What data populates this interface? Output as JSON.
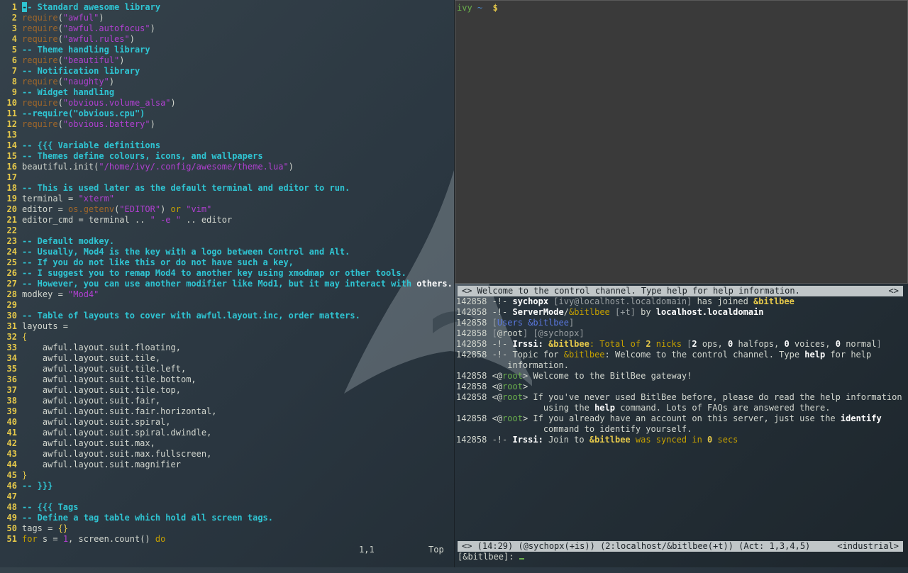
{
  "editor": {
    "lines": [
      [
        [
          "comment",
          "-- Standard awesome library"
        ]
      ],
      [
        [
          "req",
          "require"
        ],
        [
          "plain",
          "("
        ],
        [
          "string",
          "\"awful\""
        ],
        [
          "plain",
          ")"
        ]
      ],
      [
        [
          "req",
          "require"
        ],
        [
          "plain",
          "("
        ],
        [
          "string",
          "\"awful.autofocus\""
        ],
        [
          "plain",
          ")"
        ]
      ],
      [
        [
          "req",
          "require"
        ],
        [
          "plain",
          "("
        ],
        [
          "string",
          "\"awful.rules\""
        ],
        [
          "plain",
          ")"
        ]
      ],
      [
        [
          "comment",
          "-- Theme handling library"
        ]
      ],
      [
        [
          "req",
          "require"
        ],
        [
          "plain",
          "("
        ],
        [
          "string",
          "\"beautiful\""
        ],
        [
          "plain",
          ")"
        ]
      ],
      [
        [
          "comment",
          "-- Notification library"
        ]
      ],
      [
        [
          "req",
          "require"
        ],
        [
          "plain",
          "("
        ],
        [
          "string",
          "\"naughty\""
        ],
        [
          "plain",
          ")"
        ]
      ],
      [
        [
          "comment",
          "-- Widget handling"
        ]
      ],
      [
        [
          "req",
          "require"
        ],
        [
          "plain",
          "("
        ],
        [
          "string",
          "\"obvious.volume_alsa\""
        ],
        [
          "plain",
          ")"
        ]
      ],
      [
        [
          "comment",
          "--require(\"obvious.cpu\")"
        ]
      ],
      [
        [
          "req",
          "require"
        ],
        [
          "plain",
          "("
        ],
        [
          "string",
          "\"obvious.battery\""
        ],
        [
          "plain",
          ")"
        ]
      ],
      [],
      [
        [
          "comment",
          "-- {{{ Variable definitions"
        ]
      ],
      [
        [
          "comment",
          "-- Themes define colours, icons, and wallpapers"
        ]
      ],
      [
        [
          "plain",
          "beautiful.init("
        ],
        [
          "string",
          "\"/home/ivy/.config/awesome/theme.lua\""
        ],
        [
          "plain",
          ")"
        ]
      ],
      [],
      [
        [
          "comment",
          "-- This is used later as the default terminal and editor to run."
        ]
      ],
      [
        [
          "plain",
          "terminal = "
        ],
        [
          "string",
          "\"xterm\""
        ]
      ],
      [
        [
          "plain",
          "editor = "
        ],
        [
          "req",
          "os.getenv"
        ],
        [
          "plain",
          "("
        ],
        [
          "string",
          "\"EDITOR\""
        ],
        [
          "plain",
          ") "
        ],
        [
          "keyword",
          "or"
        ],
        [
          "plain",
          " "
        ],
        [
          "string",
          "\"vim\""
        ]
      ],
      [
        [
          "plain",
          "editor_cmd = terminal .. "
        ],
        [
          "string",
          "\" -e \""
        ],
        [
          "plain",
          " .. editor"
        ]
      ],
      [],
      [
        [
          "comment",
          "-- Default modkey."
        ]
      ],
      [
        [
          "comment",
          "-- Usually, Mod4 is the key with a logo between Control and Alt."
        ]
      ],
      [
        [
          "comment",
          "-- If you do not like this or do not have such a key,"
        ]
      ],
      [
        [
          "comment",
          "-- I suggest you to remap Mod4 to another key using xmodmap or other tools."
        ]
      ],
      [
        [
          "comment",
          "-- However, you can use another modifier like Mod1, but it may interact with "
        ],
        [
          "white",
          "others."
        ]
      ],
      [
        [
          "plain",
          "modkey = "
        ],
        [
          "string",
          "\"Mod4\""
        ]
      ],
      [],
      [
        [
          "comment",
          "-- Table of layouts to cover with awful.layout.inc, order matters."
        ]
      ],
      [
        [
          "plain",
          "layouts ="
        ]
      ],
      [
        [
          "brace",
          "{"
        ]
      ],
      [
        [
          "plain",
          "    awful.layout.suit.floating,"
        ]
      ],
      [
        [
          "plain",
          "    awful.layout.suit.tile,"
        ]
      ],
      [
        [
          "plain",
          "    awful.layout.suit.tile.left,"
        ]
      ],
      [
        [
          "plain",
          "    awful.layout.suit.tile.bottom,"
        ]
      ],
      [
        [
          "plain",
          "    awful.layout.suit.tile.top,"
        ]
      ],
      [
        [
          "plain",
          "    awful.layout.suit.fair,"
        ]
      ],
      [
        [
          "plain",
          "    awful.layout.suit.fair.horizontal,"
        ]
      ],
      [
        [
          "plain",
          "    awful.layout.suit.spiral,"
        ]
      ],
      [
        [
          "plain",
          "    awful.layout.suit.spiral.dwindle,"
        ]
      ],
      [
        [
          "plain",
          "    awful.layout.suit.max,"
        ]
      ],
      [
        [
          "plain",
          "    awful.layout.suit.max.fullscreen,"
        ]
      ],
      [
        [
          "plain",
          "    awful.layout.suit.magnifier"
        ]
      ],
      [
        [
          "brace",
          "}"
        ]
      ],
      [
        [
          "comment",
          "-- }}}"
        ]
      ],
      [],
      [
        [
          "comment",
          "-- {{{ Tags"
        ]
      ],
      [
        [
          "comment",
          "-- Define a tag table which hold all screen tags."
        ]
      ],
      [
        [
          "plain",
          "tags = "
        ],
        [
          "brace",
          "{}"
        ]
      ],
      [
        [
          "keyword",
          "for"
        ],
        [
          "plain",
          " s = "
        ],
        [
          "num",
          "1"
        ],
        [
          "plain",
          ", screen.count() "
        ],
        [
          "keyword",
          "do"
        ]
      ]
    ],
    "ruler": "1,1",
    "position": "Top"
  },
  "terminal": {
    "host": "ivy",
    "dir": "~",
    "prompt": "$"
  },
  "irssi": {
    "topbar_left": "<> Welcome to the control channel. Type help for help information.",
    "topbar_right": "<>",
    "lines": [
      [
        [
          "ts",
          "142858"
        ],
        [
          "plain",
          " -!- "
        ],
        [
          "bold",
          "sychopx"
        ],
        [
          "dim",
          " [ivy@localhost.localdomain]"
        ],
        [
          "plain",
          " has joined "
        ],
        [
          "chan",
          "&bitlbee"
        ]
      ],
      [
        [
          "ts",
          "142858"
        ],
        [
          "plain",
          " -!- "
        ],
        [
          "bold",
          "ServerMode"
        ],
        [
          "plain",
          "/"
        ],
        [
          "chandim",
          "&bitlbee"
        ],
        [
          "dim",
          " [+t]"
        ],
        [
          "plain",
          " by "
        ],
        [
          "bold",
          "localhost.localdomain"
        ]
      ],
      [
        [
          "ts",
          "142858"
        ],
        [
          "plain",
          " "
        ],
        [
          "dim",
          "["
        ],
        [
          "blue",
          "Users &bitlbee"
        ],
        [
          "dim",
          "]"
        ]
      ],
      [
        [
          "ts",
          "142858"
        ],
        [
          "plain",
          " "
        ],
        [
          "dim",
          "["
        ],
        [
          "plain",
          "@root"
        ],
        [
          "dim",
          "]"
        ],
        [
          "plain",
          " "
        ],
        [
          "dim",
          "[@sychopx]"
        ]
      ],
      [
        [
          "ts",
          "142858"
        ],
        [
          "plain",
          " -!- "
        ],
        [
          "bold",
          "Irssi: "
        ],
        [
          "chan",
          "&bitlbee"
        ],
        [
          "amber",
          ": Total of "
        ],
        [
          "chan",
          "2"
        ],
        [
          "amber",
          " nicks "
        ],
        [
          "dim",
          "["
        ],
        [
          "bold",
          "2"
        ],
        [
          "plain",
          " ops, "
        ],
        [
          "bold",
          "0"
        ],
        [
          "plain",
          " halfops, "
        ],
        [
          "bold",
          "0"
        ],
        [
          "plain",
          " voices, "
        ],
        [
          "bold",
          "0"
        ],
        [
          "plain",
          " normal"
        ],
        [
          "dim",
          "]"
        ]
      ],
      [
        [
          "ts",
          "142858"
        ],
        [
          "plain",
          " -!- Topic for "
        ],
        [
          "chandim",
          "&bitlbee"
        ],
        [
          "plain",
          ": Welcome to the control channel. Type "
        ],
        [
          "bold",
          "help"
        ],
        [
          "plain",
          " for help"
        ]
      ],
      [
        [
          "plain",
          "          information."
        ]
      ],
      [
        [
          "ts",
          "142858"
        ],
        [
          "plain",
          " <@"
        ],
        [
          "green",
          "root"
        ],
        [
          "plain",
          "> Welcome to the BitlBee gateway!"
        ]
      ],
      [
        [
          "ts",
          "142858"
        ],
        [
          "plain",
          " <@"
        ],
        [
          "green",
          "root"
        ],
        [
          "plain",
          ">"
        ]
      ],
      [
        [
          "ts",
          "142858"
        ],
        [
          "plain",
          " <@"
        ],
        [
          "green",
          "root"
        ],
        [
          "plain",
          "> If you've never used BitlBee before, please do read the help information"
        ]
      ],
      [
        [
          "plain",
          "                 using the "
        ],
        [
          "bold",
          "help"
        ],
        [
          "plain",
          " command. Lots of FAQs are answered there."
        ]
      ],
      [
        [
          "ts",
          "142858"
        ],
        [
          "plain",
          " <@"
        ],
        [
          "green",
          "root"
        ],
        [
          "plain",
          "> If you already have an account on this server, just use the "
        ],
        [
          "bold",
          "identify"
        ]
      ],
      [
        [
          "plain",
          "                 command to identify yourself."
        ]
      ],
      [
        [
          "ts",
          "142858"
        ],
        [
          "plain",
          " -!- "
        ],
        [
          "bold",
          "Irssi: "
        ],
        [
          "plain",
          "Join to "
        ],
        [
          "chan",
          "&bitlbee"
        ],
        [
          "amber",
          " was synced in "
        ],
        [
          "chan",
          "0"
        ],
        [
          "amber",
          " secs"
        ]
      ]
    ],
    "status_left": "<> (14:29) (@sychopx(+is)) (2:localhost/&bitlbee(+t)) (Act: 1,3,4,5)",
    "status_right": "<industrial>",
    "input_prompt": "[&bitlbee]: "
  }
}
